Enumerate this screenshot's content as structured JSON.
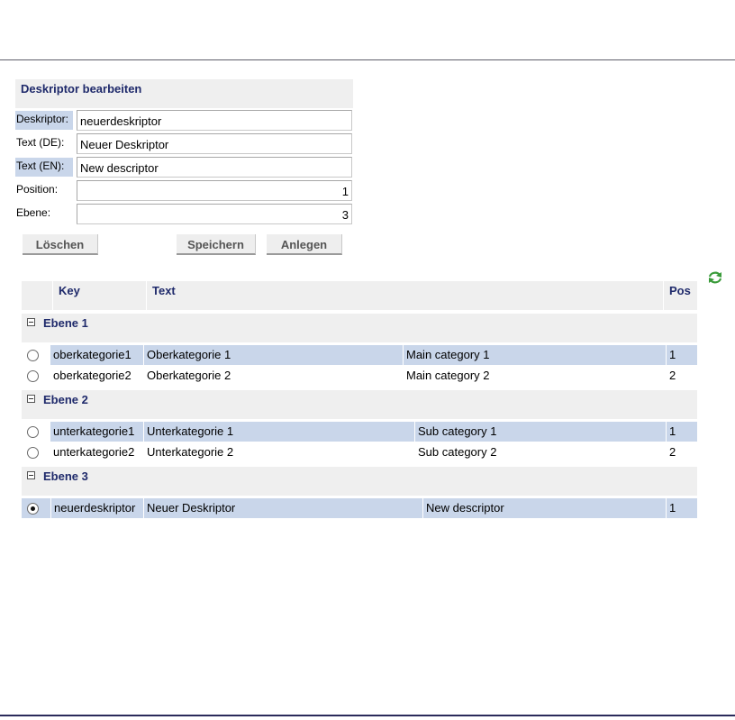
{
  "form": {
    "title": "Deskriptor bearbeiten",
    "fields": [
      {
        "label": "Deskriptor:",
        "value": "neuerdeskriptor"
      },
      {
        "label": "Text (DE):",
        "value": "Neuer Deskriptor"
      },
      {
        "label": "Text (EN):",
        "value": "New descriptor"
      },
      {
        "label": "Position:",
        "value": "1"
      },
      {
        "label": "Ebene:",
        "value": "3"
      }
    ],
    "buttons": {
      "delete": "Löschen",
      "save": "Speichern",
      "create": "Anlegen"
    }
  },
  "table": {
    "headers": {
      "key": "Key",
      "text": "Text",
      "pos": "Pos"
    },
    "groups": [
      {
        "label": "Ebene 1",
        "rows": [
          {
            "key": "oberkategorie1",
            "de": "Oberkategorie 1",
            "en": "Main category 1",
            "pos": "1",
            "selected": false
          },
          {
            "key": "oberkategorie2",
            "de": "Oberkategorie 2",
            "en": "Main category 2",
            "pos": "2",
            "selected": false
          }
        ]
      },
      {
        "label": "Ebene 2",
        "rows": [
          {
            "key": "unterkategorie1",
            "de": "Unterkategorie 1",
            "en": "Sub category 1",
            "pos": "1",
            "selected": false
          },
          {
            "key": "unterkategorie2",
            "de": "Unterkategorie 2",
            "en": "Sub category 2",
            "pos": "2",
            "selected": false
          }
        ]
      },
      {
        "label": "Ebene 3",
        "rows": [
          {
            "key": "neuerdeskriptor",
            "de": "Neuer Deskriptor",
            "en": "New descriptor",
            "pos": "1",
            "selected": true
          }
        ]
      }
    ]
  },
  "icons": {
    "refresh": "refresh-icon",
    "group_toggle": "collapse-minus-icon"
  },
  "colors": {
    "heading": "#1f2a6b",
    "highlight": "#c9d6ea",
    "panel": "#efefef",
    "refresh": "#3a9b3a"
  }
}
